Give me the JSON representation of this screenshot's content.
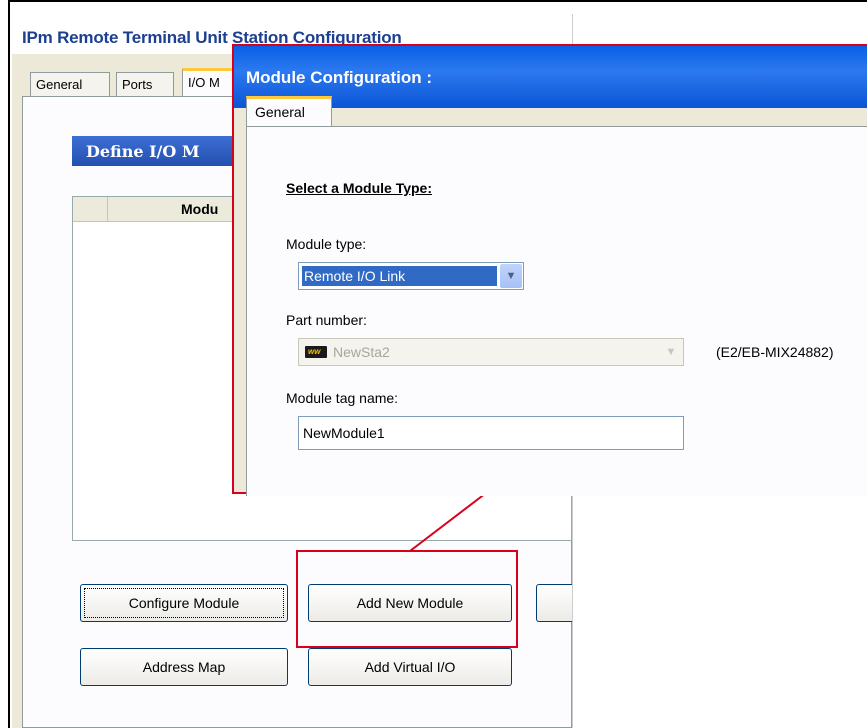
{
  "back_window": {
    "title": "IPm Remote Terminal Unit Station Configuration",
    "tabs": [
      "General",
      "Ports",
      "I/O M"
    ],
    "section_header": "Define I/O M",
    "list_header": "Modu",
    "buttons": {
      "configure_module": "Configure Module",
      "add_new_module": "Add New Module",
      "address_map": "Address Map",
      "add_virtual_io": "Add Virtual I/O"
    }
  },
  "dialog": {
    "title": "Module Configuration :",
    "tab": "General",
    "section_heading": "Select a Module Type:",
    "module_type_label": "Module type:",
    "module_type_value": "Remote I/O Link",
    "part_number_label": "Part number:",
    "part_number_value": "NewSta2",
    "part_number_code": "(E2/EB-MIX24882)",
    "tag_name_label": "Module tag name:",
    "tag_name_value": "NewModule1"
  },
  "colors": {
    "highlight_red": "#d9001b",
    "title_blue": "#0a5fe6",
    "selection_blue": "#316ac5"
  }
}
